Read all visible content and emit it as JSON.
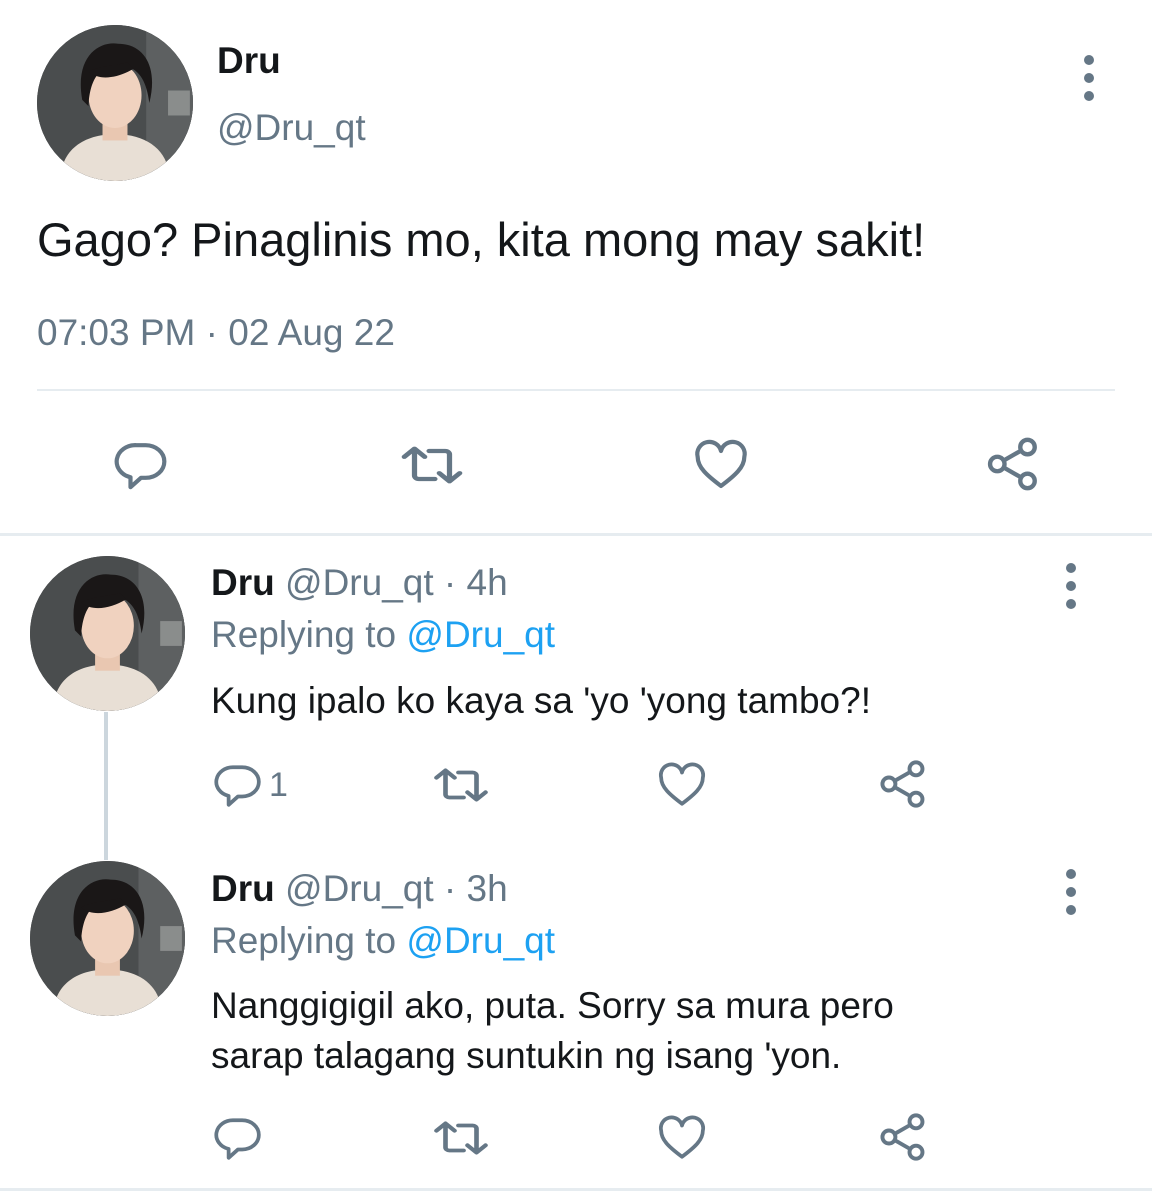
{
  "main_tweet": {
    "name": "Dru",
    "handle": "@Dru_qt",
    "text": "Gago? Pinaglinis mo, kita mong may sakit!",
    "timestamp": "07:03 PM · 02 Aug 22",
    "actions": [
      "reply-icon",
      "retweet-icon",
      "like-icon",
      "share-icon"
    ]
  },
  "replies": [
    {
      "name": "Dru",
      "meta": "@Dru_qt · 4h",
      "replying_prefix": "Replying to ",
      "replying_to": "@Dru_qt",
      "text": "Kung ipalo ko kaya sa 'yo 'yong tambo?!",
      "reply_count": "1"
    },
    {
      "name": "Dru",
      "meta": "@Dru_qt · 3h",
      "replying_prefix": "Replying to ",
      "replying_to": "@Dru_qt",
      "text_line1": "Nanggigigil ako, puta. Sorry sa mura pero",
      "text_line2": "sarap talagang suntukin ng isang 'yon.",
      "reply_count": ""
    }
  ],
  "colors": {
    "text": "#14171a",
    "secondary": "#657786",
    "link": "#1da1f2",
    "divider": "#e6ecf0"
  }
}
